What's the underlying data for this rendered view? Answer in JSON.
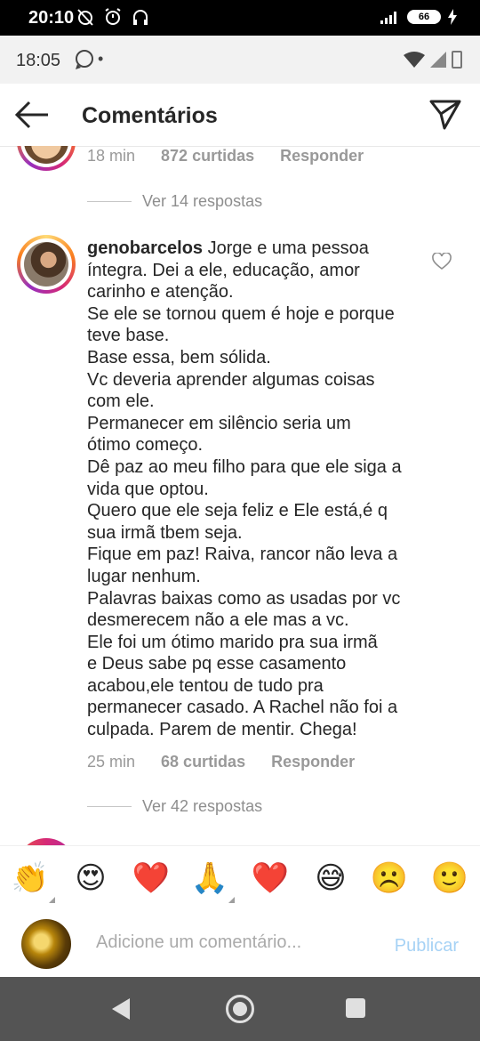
{
  "outer_status": {
    "time": "20:10",
    "battery": "66"
  },
  "inner_status": {
    "time": "18:05",
    "extra": "•"
  },
  "header": {
    "title": "Comentários",
    "back_icon": "arrow-left-icon",
    "share_icon": "paper-plane-icon"
  },
  "prev_comment": {
    "time": "18 min",
    "likes": "872 curtidas",
    "reply": "Responder",
    "view_replies": "Ver 14 respostas"
  },
  "comment": {
    "username": "genobarcelos",
    "lines": [
      "Jorge e uma pessoa",
      "íntegra. Dei a ele, educação, amor",
      "carinho e atenção.",
      "Se ele se tornou quem é hoje e porque",
      "teve base.",
      "Base essa, bem sólida.",
      "Vc deveria aprender algumas coisas",
      "com ele.",
      "Permanecer em silêncio seria um",
      "ótimo começo.",
      "Dê paz ao meu filho para que ele siga a",
      "vida que optou.",
      "Quero que ele seja feliz e Ele está,é q",
      "sua irmã tbem seja.",
      "Fique em paz! Raiva, rancor não leva a",
      "lugar nenhum.",
      "Palavras baixas como as usadas por vc",
      "desmerecem não a ele mas a vc.",
      "Ele foi um ótimo marido pra sua irmã",
      "e Deus sabe pq esse casamento",
      "acabou,ele tentou de tudo pra",
      "permanecer casado. A Rachel não foi a",
      "culpada. Parem de mentir. Chega!"
    ],
    "time": "25 min",
    "likes": "68 curtidas",
    "reply": "Responder",
    "view_replies": "Ver 42 respostas"
  },
  "emoji_bar": [
    "👏",
    "😍",
    "❤️",
    "🙏",
    "❤️",
    "😅",
    "☹️",
    "🙂"
  ],
  "composer": {
    "placeholder": "Adicione um comentário...",
    "publish": "Publicar"
  }
}
